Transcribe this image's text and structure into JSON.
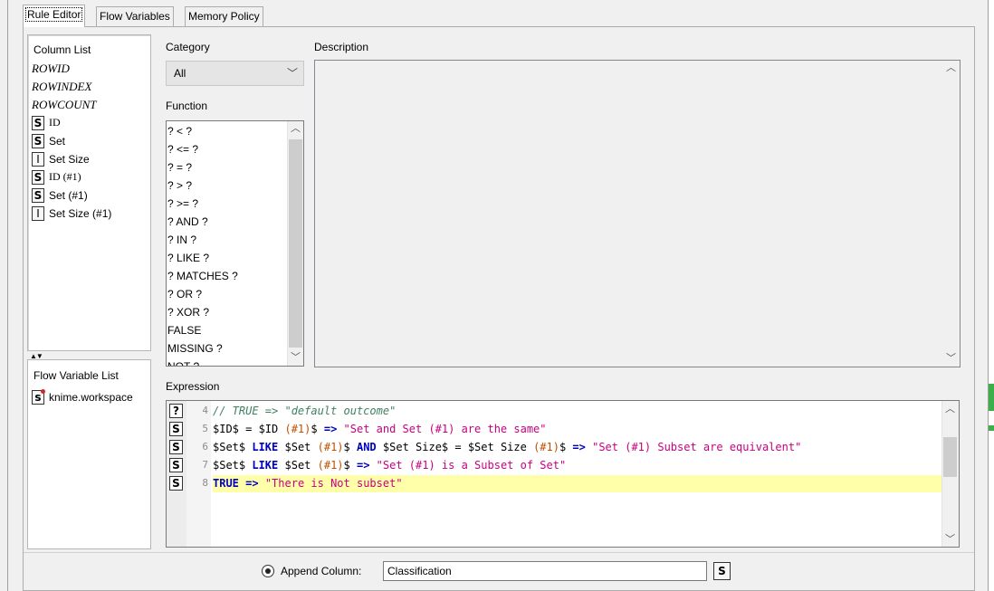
{
  "tabs": [
    "Rule Editor",
    "Flow Variables",
    "Memory Policy"
  ],
  "column_list": {
    "title": "Column List",
    "special": [
      "ROWID",
      "ROWINDEX",
      "ROWCOUNT"
    ],
    "columns": [
      {
        "type": "S",
        "name": "ID"
      },
      {
        "type": "S",
        "name": "Set"
      },
      {
        "type": "I",
        "name": "Set Size"
      },
      {
        "type": "S",
        "name": "ID (#1)"
      },
      {
        "type": "S",
        "name": "Set (#1)"
      },
      {
        "type": "I",
        "name": "Set Size (#1)"
      }
    ]
  },
  "flow_variable_list": {
    "title": "Flow Variable List",
    "items": [
      {
        "type": "s",
        "name": "knime.workspace"
      }
    ]
  },
  "category": {
    "label": "Category",
    "selected": "All"
  },
  "function": {
    "label": "Function",
    "items": [
      "? < ?",
      "? <= ?",
      "? = ?",
      "? > ?",
      "? >= ?",
      "? AND ?",
      "? IN ?",
      "? LIKE ?",
      "? MATCHES ?",
      "? OR ?",
      "? XOR ?",
      "FALSE",
      "MISSING ?",
      "NOT ?"
    ]
  },
  "description": {
    "label": "Description"
  },
  "expression": {
    "label": "Expression",
    "lines": [
      {
        "num": "4",
        "icon": "?",
        "text": "// TRUE => \"default outcome\""
      },
      {
        "num": "5",
        "icon": "S",
        "text": "$ID$ = $ID (#1)$ => \"Set and Set (#1) are the same\""
      },
      {
        "num": "6",
        "icon": "S",
        "text": "$Set$ LIKE $Set (#1)$ AND $Set Size$ = $Set Size (#1)$ => \"Set (#1) Subset are equivalent\""
      },
      {
        "num": "7",
        "icon": "S",
        "text": "$Set$ LIKE $Set (#1)$ => \"Set (#1) is a Subset of Set\""
      },
      {
        "num": "8",
        "icon": "S",
        "text": "TRUE => \"There is Not subset\""
      }
    ]
  },
  "append_column": {
    "label": "Append Column:",
    "value": "Classification",
    "type": "S"
  }
}
